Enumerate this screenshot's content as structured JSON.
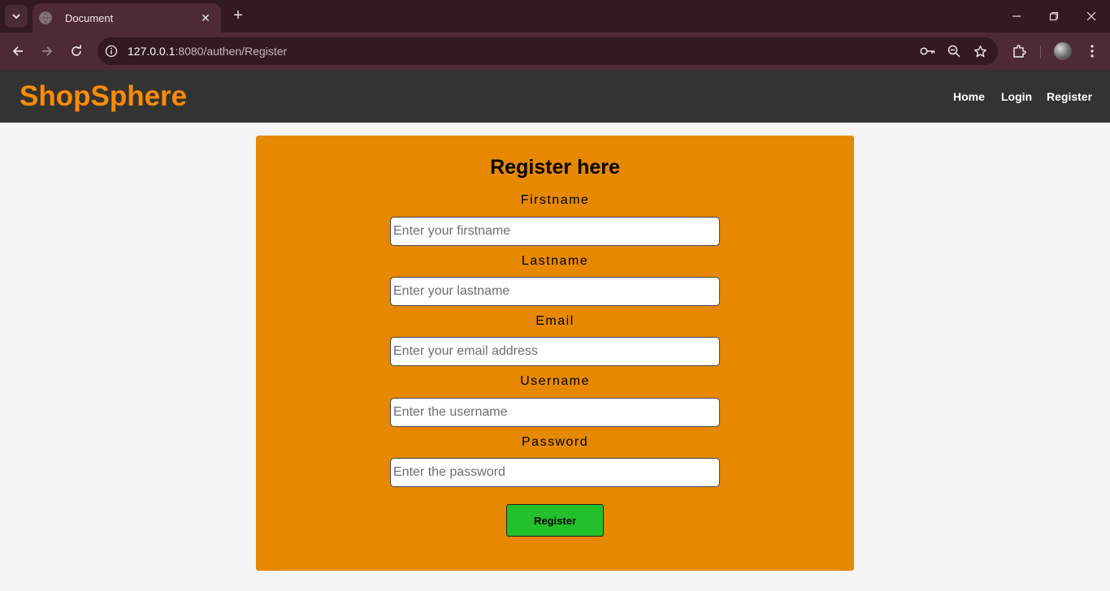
{
  "browser": {
    "tab_title": "Document",
    "url_host": "127.0.0.1",
    "url_rest": ":8080/authen/Register"
  },
  "header": {
    "logo": "ShopSphere",
    "nav": [
      "Home",
      "Login",
      "Register"
    ]
  },
  "form": {
    "title": "Register here",
    "fields": [
      {
        "label": "Firstname",
        "placeholder": "Enter your firstname",
        "value": ""
      },
      {
        "label": "Lastname",
        "placeholder": "Enter your lastname",
        "value": ""
      },
      {
        "label": "Email",
        "placeholder": "Enter your email address",
        "value": ""
      },
      {
        "label": "Username",
        "placeholder": "Enter the username",
        "value": ""
      },
      {
        "label": "Password",
        "placeholder": "Enter the password",
        "value": ""
      }
    ],
    "submit_label": "Register"
  },
  "colors": {
    "logo": "#ff8c00",
    "header_bg": "#333333",
    "card_bg": "#e68900",
    "button_bg": "#22c02a",
    "page_bg": "#f4f4f4"
  },
  "icons": {
    "tab_menu": "chevron-down-icon",
    "favicon": "globe-icon",
    "tab_close": "close-icon",
    "new_tab": "plus-icon",
    "back": "arrow-left-icon",
    "forward": "arrow-right-icon",
    "reload": "reload-icon",
    "site_info": "info-icon",
    "password_key": "key-icon",
    "zoom": "zoom-out-icon",
    "bookmark": "star-icon",
    "extensions": "puzzle-icon",
    "menu": "kebab-menu-icon"
  }
}
